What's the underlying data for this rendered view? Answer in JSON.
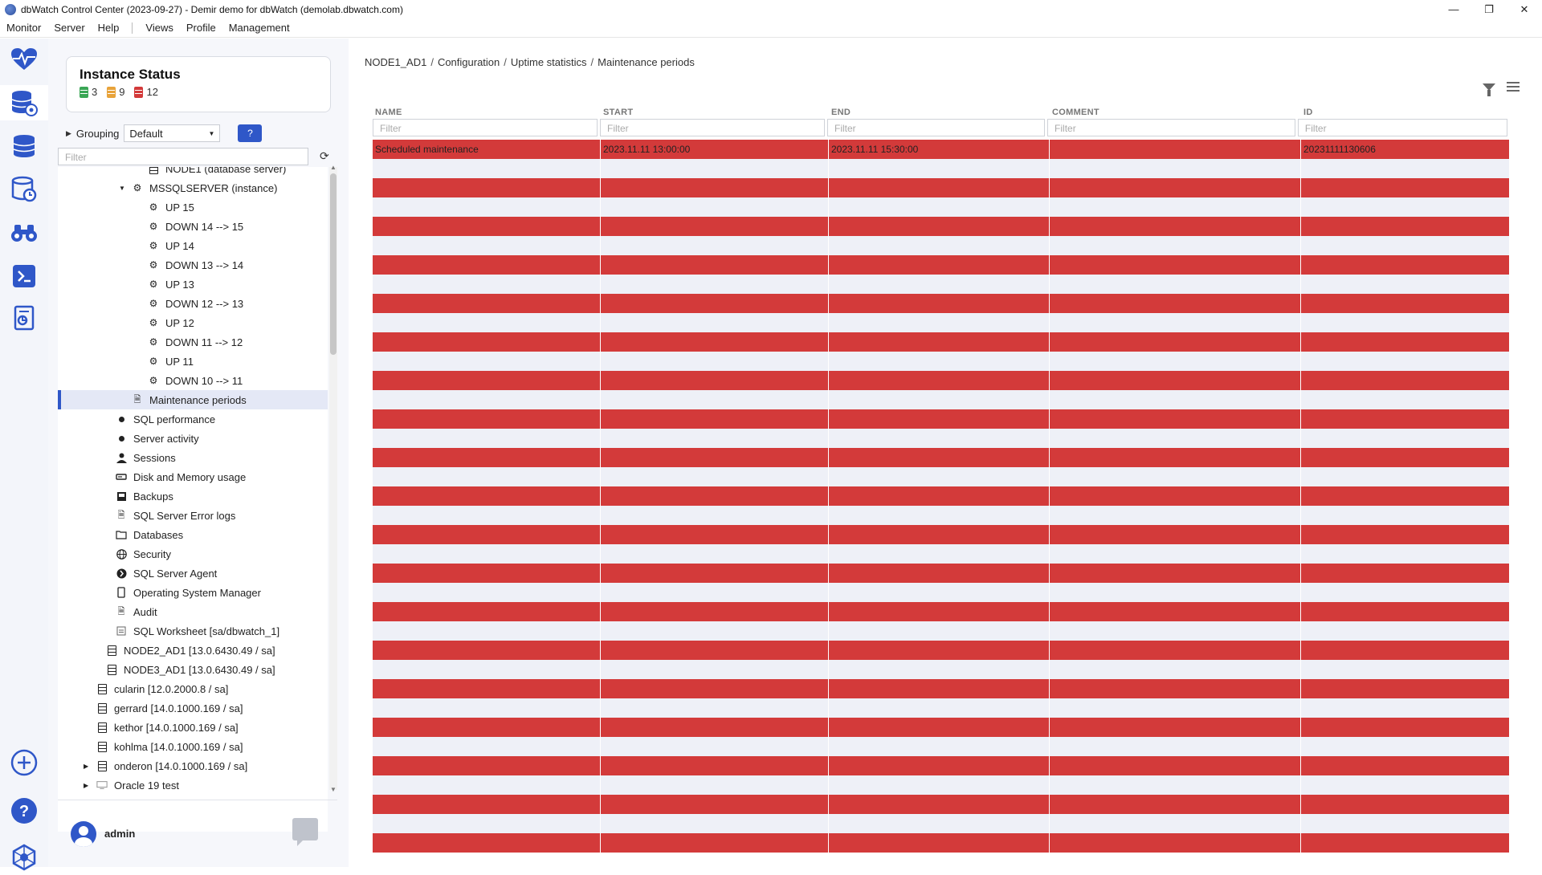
{
  "window": {
    "title": "dbWatch Control Center  (2023-09-27) - Demir demo for dbWatch (demolab.dbwatch.com)",
    "minimize": "—",
    "restore": "❐",
    "close": "✕"
  },
  "menu": {
    "items": [
      "Monitor",
      "Server",
      "Help",
      "Views",
      "Profile",
      "Management"
    ]
  },
  "rail": {
    "icons": [
      "heartbeat-icon",
      "database-settings-icon",
      "database-stack-icon",
      "database-clock-icon",
      "binoculars-icon",
      "terminal-icon",
      "report-icon",
      "add-icon",
      "help-icon",
      "network-icon"
    ]
  },
  "status": {
    "title": "Instance Status",
    "green": "3",
    "orange": "9",
    "red": "12",
    "colors": {
      "green": "#3aa655",
      "orange": "#e8a33a",
      "red": "#d33a3a"
    }
  },
  "grouping": {
    "label": "Grouping",
    "value": "Default",
    "help": "?"
  },
  "tree_filter": {
    "placeholder": "Filter"
  },
  "tree": {
    "rows": [
      {
        "label": "NODE1 (database server)",
        "indent": 112,
        "icon": "server"
      },
      {
        "label": "MSSQLSERVER (instance)",
        "indent": 92,
        "icon": "gear",
        "arrow": "▼"
      },
      {
        "label": "UP 15",
        "indent": 112,
        "icon": "gear"
      },
      {
        "label": "DOWN 14 --> 15",
        "indent": 112,
        "icon": "gear"
      },
      {
        "label": "UP 14",
        "indent": 112,
        "icon": "gear"
      },
      {
        "label": "DOWN 13 --> 14",
        "indent": 112,
        "icon": "gear"
      },
      {
        "label": "UP 13",
        "indent": 112,
        "icon": "gear"
      },
      {
        "label": "DOWN 12 --> 13",
        "indent": 112,
        "icon": "gear"
      },
      {
        "label": "UP 12",
        "indent": 112,
        "icon": "gear"
      },
      {
        "label": "DOWN 11 --> 12",
        "indent": 112,
        "icon": "gear"
      },
      {
        "label": "UP 11",
        "indent": 112,
        "icon": "gear"
      },
      {
        "label": "DOWN 10 --> 11",
        "indent": 112,
        "icon": "gear"
      },
      {
        "label": "Maintenance periods",
        "indent": 92,
        "icon": "doc",
        "selected": true
      },
      {
        "label": "SQL performance",
        "indent": 72,
        "icon": "dot"
      },
      {
        "label": "Server activity",
        "indent": 72,
        "icon": "dot"
      },
      {
        "label": "Sessions",
        "indent": 72,
        "icon": "user"
      },
      {
        "label": "Disk and Memory usage",
        "indent": 72,
        "icon": "disk"
      },
      {
        "label": "Backups",
        "indent": 72,
        "icon": "backup"
      },
      {
        "label": "SQL Server Error logs",
        "indent": 72,
        "icon": "doc"
      },
      {
        "label": "Databases",
        "indent": 72,
        "icon": "folder"
      },
      {
        "label": "Security",
        "indent": 72,
        "icon": "globe"
      },
      {
        "label": "SQL Server Agent",
        "indent": 72,
        "icon": "agent"
      },
      {
        "label": "Operating System Manager",
        "indent": 72,
        "icon": "phone"
      },
      {
        "label": "Audit",
        "indent": 72,
        "icon": "doc"
      },
      {
        "label": "SQL Worksheet [sa/dbwatch_1]",
        "indent": 72,
        "icon": "sheet"
      },
      {
        "label": "NODE2_AD1 [13.0.6430.49 / sa]",
        "indent": 60,
        "icon": "server"
      },
      {
        "label": "NODE3_AD1 [13.0.6430.49 / sa]",
        "indent": 60,
        "icon": "server"
      },
      {
        "label": "cularin [12.0.2000.8 / sa]",
        "indent": 48,
        "icon": "server"
      },
      {
        "label": "gerrard [14.0.1000.169 / sa]",
        "indent": 48,
        "icon": "server"
      },
      {
        "label": "kethor [14.0.1000.169 / sa]",
        "indent": 48,
        "icon": "server"
      },
      {
        "label": "kohlma [14.0.1000.169 / sa]",
        "indent": 48,
        "icon": "server"
      },
      {
        "label": "onderon [14.0.1000.169 / sa]",
        "indent": 48,
        "icon": "server",
        "arrow": "▶"
      },
      {
        "label": "Oracle 19 test",
        "indent": 48,
        "icon": "oracle",
        "arrow": "▶"
      }
    ]
  },
  "user": {
    "name": "admin"
  },
  "breadcrumb": [
    "NODE1_AD1",
    "Configuration",
    "Uptime statistics",
    "Maintenance periods"
  ],
  "grid": {
    "columns": [
      "NAME",
      "START",
      "END",
      "COMMENT",
      "ID"
    ],
    "filter_placeholder": "Filter",
    "rows": [
      [
        "Scheduled maintenance",
        "2023.11.11 13:00:00",
        "2023.11.11 15:30:00",
        "",
        "20231111130606"
      ]
    ],
    "empty_rows": 36
  }
}
